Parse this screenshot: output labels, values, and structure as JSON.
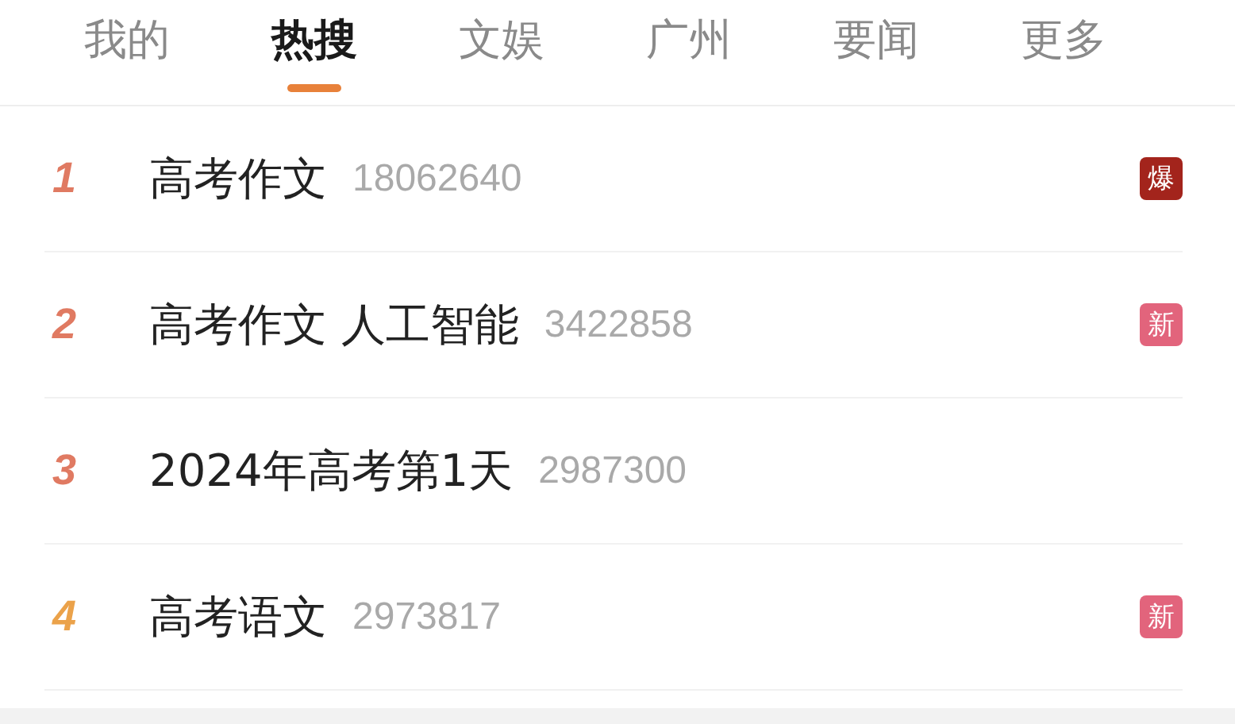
{
  "tabs": [
    {
      "label": "我的",
      "selected": false
    },
    {
      "label": "热搜",
      "selected": true
    },
    {
      "label": "文娱",
      "selected": false
    },
    {
      "label": "广州",
      "selected": false
    },
    {
      "label": "要闻",
      "selected": false
    },
    {
      "label": "更多",
      "selected": false
    }
  ],
  "hot_list": [
    {
      "rank": "1",
      "color": "#e07a62",
      "title": "高考作文",
      "count": "18062640",
      "badge": {
        "label": "爆",
        "color": "#a3241c"
      }
    },
    {
      "rank": "2",
      "color": "#e07a62",
      "title": "高考作文 人工智能",
      "count": "3422858",
      "badge": {
        "label": "新",
        "color": "#e2647c"
      }
    },
    {
      "rank": "3",
      "color": "#e07a62",
      "title": "2024年高考第1天",
      "count": "2987300"
    },
    {
      "rank": "4",
      "color": "#eba24a",
      "title": "高考语文",
      "count": "2973817",
      "badge": {
        "label": "新",
        "color": "#e2647c"
      }
    }
  ]
}
